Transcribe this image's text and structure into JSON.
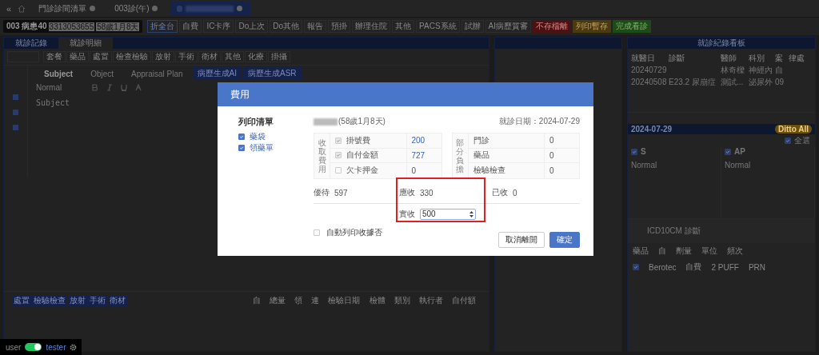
{
  "top_bar": {
    "collapse": "«",
    "tabs": [
      {
        "label": "門診診間清單",
        "selected": false
      },
      {
        "label": "003診(午)",
        "selected": false
      },
      {
        "selected": true
      }
    ]
  },
  "toolbar": {
    "patient": {
      "number": "003 病患40",
      "id": "3313053655",
      "age": "58歲1月8天"
    },
    "buttons": [
      {
        "label": "折全台",
        "kind": "outline"
      },
      {
        "label": "自費",
        "kind": "plain"
      },
      {
        "label": "IC卡序",
        "kind": "plain"
      },
      {
        "label": "Do上次",
        "kind": "plain"
      },
      {
        "label": "Do其他",
        "kind": "plain"
      },
      {
        "label": "報告",
        "kind": "plain"
      },
      {
        "label": "預掛",
        "kind": "plain"
      },
      {
        "label": "辦理住院",
        "kind": "plain"
      },
      {
        "label": "其他",
        "kind": "plain"
      },
      {
        "label": "PACS系統",
        "kind": "plain"
      },
      {
        "label": "試辦",
        "kind": "plain"
      },
      {
        "label": "AI病歷質審",
        "kind": "plain"
      },
      {
        "label": "不存檔離",
        "kind": "danger"
      },
      {
        "label": "列印暫存",
        "kind": "warning"
      },
      {
        "label": "完成看診",
        "kind": "success"
      }
    ]
  },
  "left_panel": {
    "tabs": [
      {
        "label": "就診記錄",
        "selected": false
      },
      {
        "label": "就診明細",
        "selected": true
      }
    ],
    "categories": [
      "套餐",
      "藥品",
      "處置",
      "檢查檢驗",
      "放射",
      "手術",
      "衛材",
      "其他",
      "化療",
      "掛攝"
    ],
    "editor_tabs": [
      {
        "label": "Subject",
        "selected": true
      },
      {
        "label": "Object",
        "selected": false
      },
      {
        "label": "Appraisal Plan",
        "selected": false
      }
    ],
    "ai_buttons": [
      "病歷生成AI",
      "病歷生成ASR"
    ],
    "format": "Normal",
    "placeholder": "Subject",
    "order_tabs": [
      "處置",
      "檢驗檢查",
      "放射",
      "手術",
      "衛材"
    ],
    "order_columns": [
      "自",
      "總量",
      "領",
      "連",
      "檢驗日期",
      "檢體",
      "類別",
      "執行者",
      "自付額"
    ]
  },
  "right_panel": {
    "title": "就診紀錄看板",
    "columns": [
      "就醫日",
      "診斷",
      "醫師",
      "科別",
      "案",
      "律處"
    ],
    "rows": [
      [
        "20240729",
        "",
        "林奇樑",
        "神經內",
        "自",
        ""
      ],
      [
        "20240508",
        "E23.2 尿崩症",
        "測試...",
        "泌尿外",
        "09",
        ""
      ]
    ],
    "visit_date": "2024-07-29",
    "ditto": "Ditto All",
    "select_all": {
      "label": "全選",
      "checked": true
    },
    "sections": [
      {
        "label": "S",
        "checked": true,
        "format": "Normal"
      },
      {
        "label": "AP",
        "checked": true,
        "format": "Normal"
      }
    ],
    "icd_label": "ICD10CM 診斷",
    "med_columns": [
      "藥品",
      "自",
      "劑量",
      "單位",
      "頻次"
    ],
    "med_rows": [
      {
        "checked": true,
        "cells": [
          "Berotec",
          "自費",
          "2 PUFF",
          "PRN"
        ]
      }
    ]
  },
  "user_badge": {
    "role": "user",
    "on": true,
    "name": "tester"
  },
  "dialog": {
    "title": "費用",
    "print_list": {
      "title": "列印清單",
      "items": [
        {
          "label": "藥袋",
          "checked": true
        },
        {
          "label": "領藥單",
          "checked": true
        }
      ]
    },
    "patient_age": "(58歲1月8天)",
    "visit_date": "就診日期：2024-07-29",
    "charge_group": {
      "label": "收取費用",
      "rows": [
        {
          "label": "掛號費",
          "checked": true,
          "value": "200",
          "kind": "link"
        },
        {
          "label": "自付金額",
          "checked": true,
          "value": "727",
          "kind": "link"
        },
        {
          "label": "欠卡押金",
          "checked": false,
          "value": "0",
          "kind": "plain"
        }
      ]
    },
    "copay_group": {
      "label": "部分負擔",
      "rows": [
        {
          "label": "門診",
          "value": "0"
        },
        {
          "label": "藥品",
          "value": "0"
        },
        {
          "label": "檢驗檢查",
          "value": "0"
        }
      ]
    },
    "discount": {
      "label": "優待",
      "value": "597"
    },
    "due": {
      "label": "應收",
      "value": "330"
    },
    "received": {
      "label": "已收",
      "value": "0"
    },
    "paid": {
      "label": "實收",
      "value": "500"
    },
    "auto_print": {
      "label": "自動列印收據否",
      "checked": false
    },
    "buttons": [
      {
        "label": "取消離開",
        "kind": "secondary"
      },
      {
        "label": "確定",
        "kind": "primary"
      }
    ]
  }
}
